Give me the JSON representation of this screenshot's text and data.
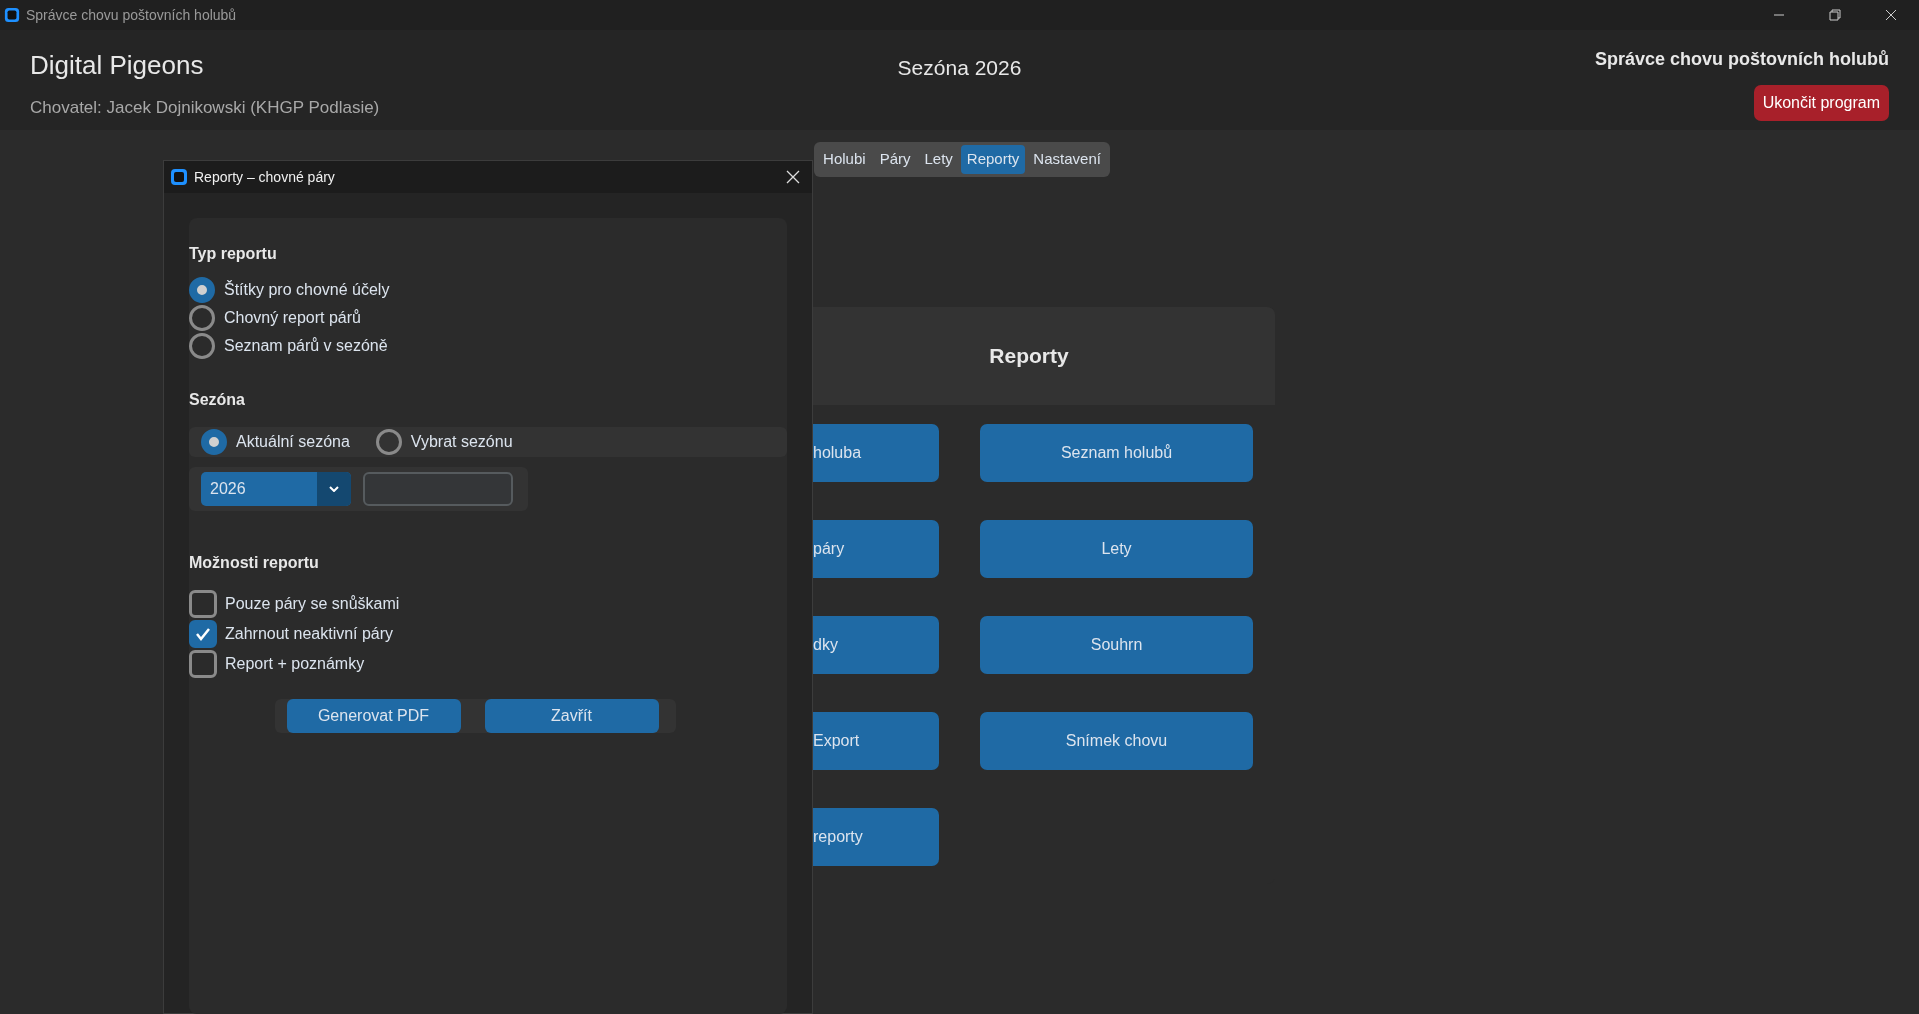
{
  "app_window": {
    "title": "Správce chovu poštovních holubů"
  },
  "header": {
    "app_name": "Digital Pigeons",
    "breeder": "Chovatel: Jacek Dojnikowski (KHGP Podlasie)",
    "season": "Sezóna 2026",
    "app_title": "Správce chovu poštovních holubů",
    "exit_button": "Ukončit program"
  },
  "tabs": [
    {
      "label": "Holubi",
      "selected": false
    },
    {
      "label": "Páry",
      "selected": false
    },
    {
      "label": "Lety",
      "selected": false
    },
    {
      "label": "Reporty",
      "selected": true
    },
    {
      "label": "Nastavení",
      "selected": false
    }
  ],
  "reports_panel": {
    "title": "Reporty",
    "buttons_left": [
      "holuba",
      "páry",
      "dky",
      "Export",
      "reporty"
    ],
    "buttons_right": [
      "Seznam holubů",
      "Lety",
      "Souhrn",
      "Snímek chovu"
    ]
  },
  "dialog": {
    "title": "Reporty – chovné páry",
    "report_type": {
      "heading": "Typ reportu",
      "options": [
        {
          "label": "Štítky pro chovné účely",
          "selected": true
        },
        {
          "label": "Chovný report párů",
          "selected": false
        },
        {
          "label": "Seznam párů v sezóně",
          "selected": false
        }
      ]
    },
    "season": {
      "heading": "Sezóna",
      "options": [
        {
          "label": "Aktuální sezóna",
          "selected": true
        },
        {
          "label": "Vybrat sezónu",
          "selected": false
        }
      ],
      "year_select": {
        "value": "2026"
      }
    },
    "report_options": {
      "heading": "Možnosti reportu",
      "items": [
        {
          "label": "Pouze páry se snůškami",
          "checked": false
        },
        {
          "label": "Zahrnout neaktivní páry",
          "checked": true
        },
        {
          "label": "Report + poznámky",
          "checked": false
        }
      ]
    },
    "buttons": [
      "Generovat PDF",
      "Zavřít"
    ]
  }
}
